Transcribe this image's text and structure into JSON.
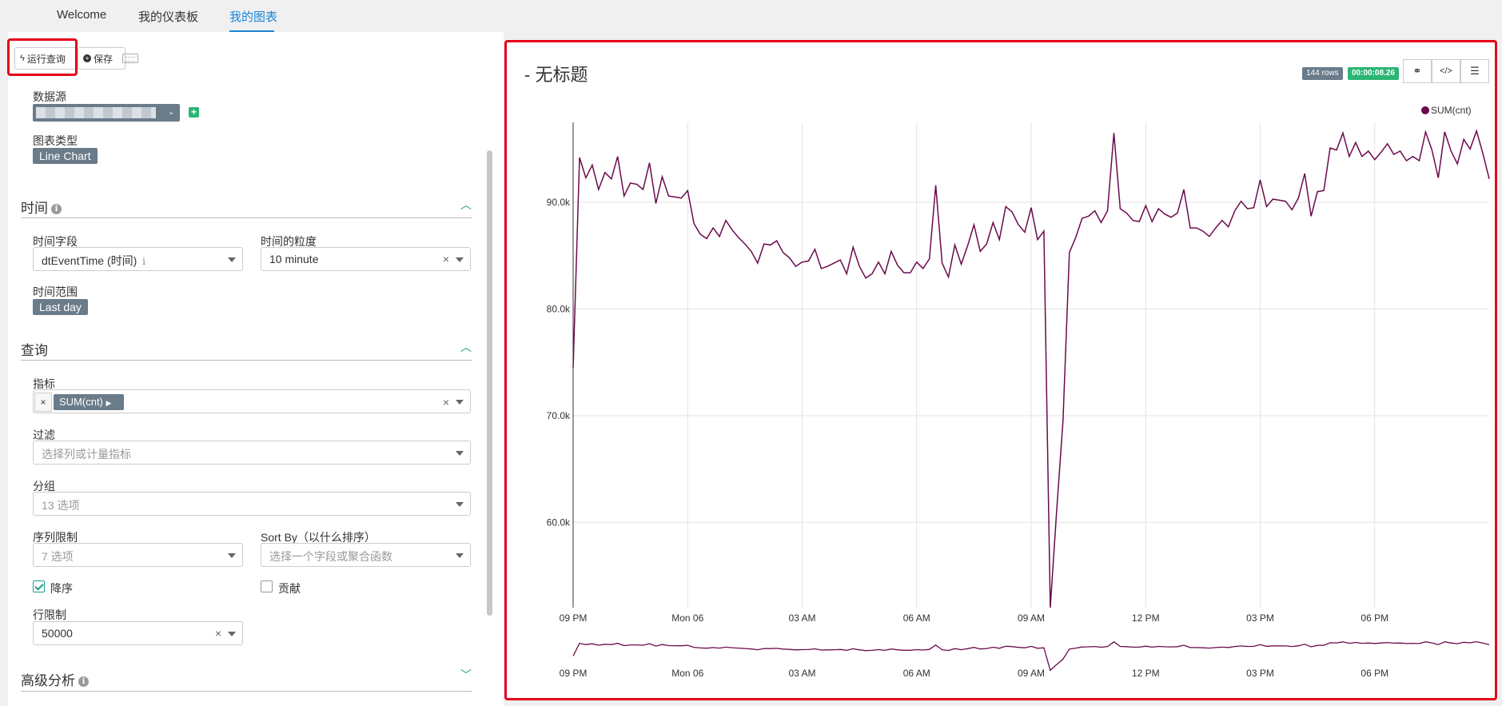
{
  "nav": {
    "tabs": [
      {
        "label": "Welcome",
        "active": false
      },
      {
        "label": "我的仪表板",
        "active": false
      },
      {
        "label": "我的图表",
        "active": true
      }
    ]
  },
  "toolbar": {
    "run_label": "运行查询",
    "save_label": "保存"
  },
  "datasource": {
    "label": "数据源"
  },
  "chart_type": {
    "label": "图表类型",
    "value": "Line Chart"
  },
  "time_section": {
    "title": "时间",
    "time_field_label": "时间字段",
    "time_field_value": "dtEventTime (时间)",
    "granularity_label": "时间的粒度",
    "granularity_value": "10 minute",
    "range_label": "时间范围",
    "range_value": "Last day"
  },
  "query_section": {
    "title": "查询",
    "metrics_label": "指标",
    "metric_tag": "SUM(cnt)",
    "filter_label": "过滤",
    "filter_placeholder": "选择列或计量指标",
    "groupby_label": "分组",
    "groupby_value": "13 选项",
    "series_limit_label": "序列限制",
    "series_limit_value": "7 选项",
    "sortby_label": "Sort By（以什么排序）",
    "sortby_placeholder": "选择一个字段或聚合函数",
    "descending_label": "降序",
    "descending_checked": true,
    "contribution_label": "贡献",
    "contribution_checked": false,
    "row_limit_label": "行限制",
    "row_limit_value": "50000"
  },
  "advanced_section": {
    "title": "高级分析"
  },
  "chart_header": {
    "title": "- 无标题",
    "rows_badge": "144 rows",
    "time_badge": "00:00:08.26"
  },
  "colors": {
    "accent": "#1a85d6",
    "series": "#6b0a4d",
    "highlight": "#e6001a",
    "success": "#2bb673"
  },
  "chart_data": {
    "type": "line",
    "title": "",
    "xlabel": "",
    "ylabel": "",
    "series": [
      {
        "name": "SUM(cnt)",
        "color": "#6b0a4d",
        "values": [
          74500,
          94200,
          92300,
          93500,
          91200,
          92800,
          92200,
          94300,
          90600,
          91800,
          91700,
          91200,
          93700,
          89900,
          92400,
          90600,
          90500,
          90400,
          91100,
          88000,
          87000,
          86600,
          87600,
          86800,
          88300,
          87400,
          86700,
          86100,
          85400,
          84300,
          86100,
          86000,
          86400,
          85300,
          84800,
          84000,
          84400,
          84500,
          85600,
          83800,
          84000,
          84300,
          84600,
          83300,
          85800,
          84000,
          82900,
          83300,
          84400,
          83300,
          85400,
          84100,
          83400,
          83400,
          84400,
          83800,
          84700,
          91600,
          84300,
          83000,
          86000,
          84200,
          85900,
          87900,
          85400,
          86100,
          88100,
          86500,
          89600,
          89100,
          87900,
          87200,
          89500,
          86500,
          87300,
          52000,
          61000,
          69500,
          85300,
          86700,
          88500,
          88700,
          89200,
          88100,
          89200,
          96500,
          89400,
          89000,
          88300,
          88200,
          89700,
          88200,
          89400,
          88900,
          88600,
          89000,
          91200,
          87600,
          87600,
          87300,
          86800,
          87600,
          88300,
          87700,
          89200,
          90100,
          89400,
          89500,
          92100,
          89600,
          90300,
          90200,
          90100,
          89300,
          90400,
          92700,
          88700,
          91000,
          91100,
          95100,
          94900,
          96500,
          94300,
          95600,
          94300,
          94800,
          94000,
          94700,
          95500,
          94500,
          94800,
          93900,
          94300,
          93900,
          96600,
          94900,
          92300,
          96600,
          94800,
          93600,
          95900,
          95000,
          96700,
          94600,
          92200
        ]
      }
    ],
    "x_tick_labels": [
      "09 PM",
      "Mon 06",
      "03 AM",
      "06 AM",
      "09 AM",
      "12 PM",
      "03 PM",
      "06 PM"
    ],
    "y_tick_labels": [
      "60.0k",
      "70.0k",
      "80.0k",
      "90.0k"
    ],
    "y_ticks": [
      60000,
      70000,
      80000,
      90000
    ],
    "ylim": [
      52000,
      97500
    ],
    "grid": true,
    "legend": "top-right",
    "has_brush": true
  }
}
